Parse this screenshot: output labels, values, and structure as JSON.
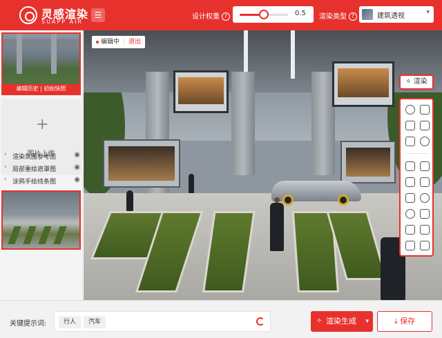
{
  "header": {
    "logo_title": "灵感渲染",
    "logo_subtitle": "SUAPP AIR",
    "weight_label": "设计权重",
    "weight_value": "0.5",
    "weight_fraction": 0.5,
    "render_type_label": "渲染类型",
    "render_type_value": "建筑透视",
    "icons": {
      "menu": "hamburger-icon",
      "help": "help-circle-icon",
      "caret": "chevron-down-icon"
    }
  },
  "sidebar": {
    "history_caption": "编辑历史 | 初始快照",
    "upload_label": "图片上传",
    "layers": [
      {
        "label": "渲染氛围参考图"
      },
      {
        "label": "局部重绘遮罩图"
      },
      {
        "label": "涂鸦手绘线条图"
      }
    ]
  },
  "canvas": {
    "edit_status": "编辑中",
    "exit_label": "退出",
    "render_label": "渲染"
  },
  "footer": {
    "keyword_label": "关键提示词:",
    "chips": [
      "行人",
      "汽车"
    ],
    "generate_label": "渲染生成",
    "save_label": "保存"
  },
  "colors": {
    "accent": "#e7312d"
  }
}
